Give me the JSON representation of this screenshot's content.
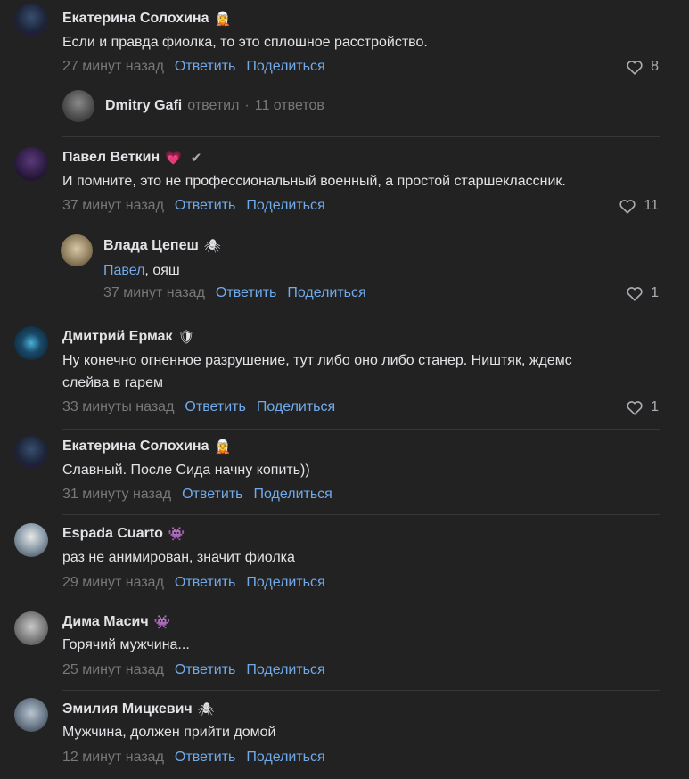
{
  "colors": {
    "background": "#222222",
    "text": "#e1e3e6",
    "muted": "#76787a",
    "link": "#71aaeb",
    "divider": "#363738"
  },
  "c1": {
    "name": "Екатерина Солохина",
    "emoji": "🧝",
    "text": "Если и правда фиолка, то это сплошное расстройство.",
    "time": "27 минут назад",
    "reply": "Ответить",
    "share": "Поделиться",
    "likes": "8"
  },
  "thread1": {
    "name": "Dmitry Gafi",
    "replied": "ответил",
    "dot": "·",
    "count": "11 ответов"
  },
  "c2": {
    "name": "Павел Веткин",
    "emoji": "💗",
    "check": "✔",
    "text": "И помните, это не профессиональный военный, а простой старшеклассник.",
    "time": "37 минут назад",
    "reply": "Ответить",
    "share": "Поделиться",
    "likes": "11"
  },
  "c2r": {
    "name": "Влада Цепеш",
    "emoji": "🕷",
    "mention": "Павел",
    "text": ", ояш",
    "time": "37 минут назад",
    "reply": "Ответить",
    "share": "Поделиться",
    "likes": "1"
  },
  "c3": {
    "name": "Дмитрий Ермак",
    "emoji": "🛡",
    "text1": "Ну конечно огненное разрушение, тут либо оно либо станер. Ништяк, ждемс",
    "text2": "слейва в гарем",
    "time": "33 минуты назад",
    "reply": "Ответить",
    "share": "Поделиться",
    "likes": "1"
  },
  "c4": {
    "name": "Екатерина Солохина",
    "emoji": "🧝",
    "text": "Славный. После Сида начну копить))",
    "time": "31 минуту назад",
    "reply": "Ответить",
    "share": "Поделиться"
  },
  "c5": {
    "name": "Espada Cuarto",
    "emoji": "👾",
    "text": "раз не анимирован, значит фиолка",
    "time": "29 минут назад",
    "reply": "Ответить",
    "share": "Поделиться"
  },
  "c6": {
    "name": "Дима Масич",
    "emoji": "👾",
    "text": "Горячий мужчина...",
    "time": "25 минут назад",
    "reply": "Ответить",
    "share": "Поделиться"
  },
  "c7": {
    "name": "Эмилия Мицкевич",
    "emoji": "🕷",
    "text": "Мужчина, должен прийти домой",
    "time": "12 минут назад",
    "reply": "Ответить",
    "share": "Поделиться"
  }
}
